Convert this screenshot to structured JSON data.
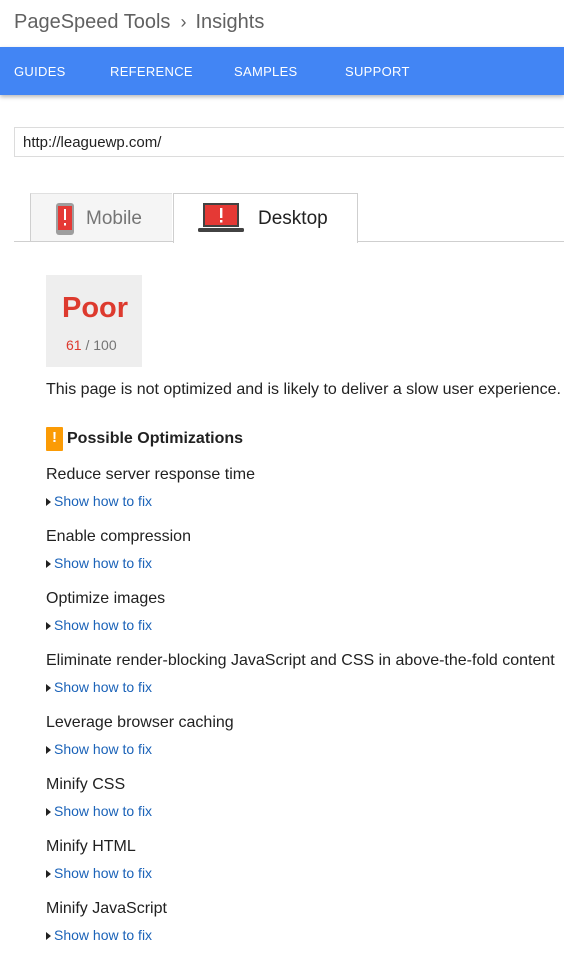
{
  "breadcrumb": {
    "product": "PageSpeed Tools",
    "separator": "›",
    "page": "Insights"
  },
  "nav": {
    "items": [
      "GUIDES",
      "REFERENCE",
      "SAMPLES",
      "SUPPORT"
    ]
  },
  "url_input": {
    "value": "http://leaguewp.com/"
  },
  "tabs": {
    "mobile": {
      "label": "Mobile",
      "icon": "mobile-phone-warning-icon"
    },
    "desktop": {
      "label": "Desktop",
      "icon": "laptop-warning-icon",
      "selected": true
    }
  },
  "score": {
    "rating": "Poor",
    "value": "61",
    "max": "/ 100",
    "color": "#dd3a2e"
  },
  "summary": "This page is not optimized and is likely to deliver a slow user experience. I",
  "optimizations": {
    "icon": "warning-icon",
    "warning_symbol": "!",
    "title": "Possible Optimizations",
    "fix_label": "Show how to fix",
    "rules": [
      "Reduce server response time",
      "Enable compression",
      "Optimize images",
      "Eliminate render-blocking JavaScript and CSS in above-the-fold content",
      "Leverage browser caching",
      "Minify CSS",
      "Minify HTML",
      "Minify JavaScript"
    ]
  },
  "colors": {
    "nav": "#4285f4",
    "poor": "#dd3a2e",
    "warning": "#fb9b05",
    "link": "#1a62b8"
  }
}
